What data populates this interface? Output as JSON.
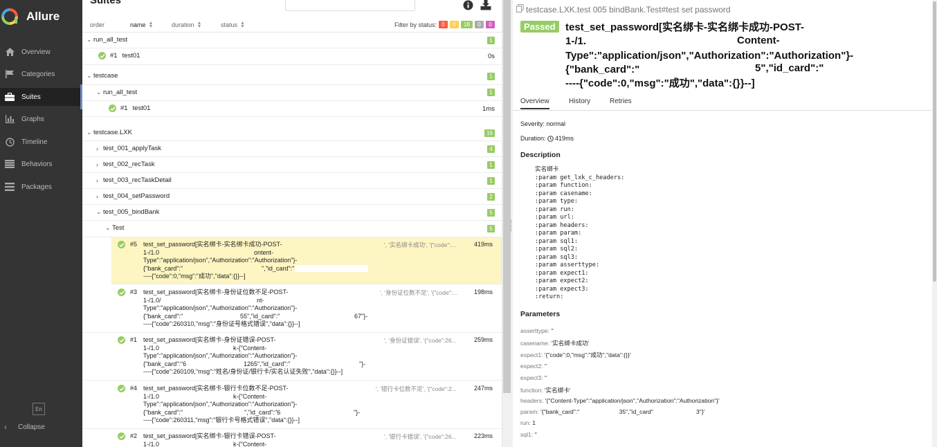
{
  "sidebar": {
    "app_name": "Allure",
    "items": [
      {
        "label": "Overview",
        "icon": "home-icon"
      },
      {
        "label": "Categories",
        "icon": "flag-icon"
      },
      {
        "label": "Suites",
        "icon": "briefcase-icon"
      },
      {
        "label": "Graphs",
        "icon": "bar-chart-icon"
      },
      {
        "label": "Timeline",
        "icon": "clock-icon"
      },
      {
        "label": "Behaviors",
        "icon": "list-icon"
      },
      {
        "label": "Packages",
        "icon": "stack-icon"
      }
    ],
    "active": "Suites",
    "language": "En",
    "collapse_label": "Collapse"
  },
  "suites": {
    "title": "Suites",
    "columns": {
      "order": "order",
      "name": "name",
      "duration": "duration",
      "status": "status"
    },
    "filter_label": "Filter by status:",
    "filter_counts": [
      {
        "value": "0",
        "color": "#fd5a3e"
      },
      {
        "value": "0",
        "color": "#ffd050"
      },
      {
        "value": "18",
        "color": "#97cc64"
      },
      {
        "value": "0",
        "color": "#aaaaaa"
      },
      {
        "value": "0",
        "color": "#d35ebe"
      }
    ],
    "groups": {
      "run_all_test": {
        "name": "run_all_test",
        "count": "1",
        "leaf_num": "#1",
        "leaf_name": "test01",
        "leaf_duration": "0s"
      },
      "testcase": {
        "name": "testcase",
        "count": "1",
        "sub_name": "run_all_test",
        "sub_count": "1",
        "leaf_num": "#1",
        "leaf_name": "test01",
        "leaf_duration": "1ms"
      },
      "lxk": {
        "name": "testcase.LXK",
        "count": "16"
      }
    },
    "subgroups": [
      {
        "name": "test_001_applyTask",
        "count": "4"
      },
      {
        "name": "test_002_recTask",
        "count": "1"
      },
      {
        "name": "test_003_recTaskDetail",
        "count": "1"
      },
      {
        "name": "test_004_setPassword",
        "count": "2"
      },
      {
        "name": "test_005_bindBank",
        "count": "5"
      },
      {
        "name": "Test",
        "count": "5"
      }
    ],
    "testcases": [
      {
        "num": "#5",
        "extra": "', '实名绑卡成功', '{\"code\":...",
        "duration": "419ms",
        "lines": [
          "test_set_password[实名绑卡-实名绑卡成功-POST-",
          "1-/1.0",
          "Type\":\"application/json\",\"Authorization\":\"Authorization\"}-",
          "{\"bank_card\":\"",
          "----{\"code\":0,\"msg\":\"成功\",\"data\":{}}--]"
        ],
        "frag2": "ontent-",
        "frag3": "\",\"id_card\":\""
      },
      {
        "num": "#3",
        "extra": "', '身份证位数不足', '{\"code\":...",
        "duration": "198ms",
        "lines": [
          "test_set_password[实名绑卡-身份证位数不足-POST-",
          "1-/1.0/",
          "Type\":\"application/json\",\"Authorization\":\"Authorization\"}-",
          "{\"bank_card\":\"",
          "----{\"code\":260310,\"msg\":\"身份证号格式错误\",\"data\":{}}--]"
        ],
        "frag2": "nt-",
        "frag3": "55\",\"id_card\":\"",
        "frag4": "67\"}-"
      },
      {
        "num": "#1",
        "extra": "', '身份证错误', '{\"code\":26...",
        "duration": "259ms",
        "lines": [
          "test_set_password[实名绑卡-身份证错误-POST-",
          "1-/1.0",
          "Type\":\"application/json\",\"Authorization\":\"Authorization\"}-",
          "{\"bank_card\":\"6",
          "----{\"code\":260109,\"msg\":\"姓名/身份证/银行卡/实名认证失败\",\"data\":{}}--]"
        ],
        "frag2": "k-{\"Content-",
        "frag3": "1265\",\"id_card\":\"",
        "frag4": "\"}-"
      },
      {
        "num": "#4",
        "extra": "', '银行卡位数不足', '{\"code\":2...",
        "duration": "247ms",
        "lines": [
          "test_set_password[实名绑卡-银行卡位数不足-POST-",
          "1-/1.0",
          "Type\":\"application/json\",\"Authorization\":\"Authorization\"}-",
          "{\"bank_card\":\"",
          "----{\"code\":260311,\"msg\":\"银行卡号格式错误\",\"data\":{}}--]"
        ],
        "frag2": "k-{\"Content-",
        "frag3": "\",\"id_card\":\"6",
        "frag4": "\"}-"
      },
      {
        "num": "#2",
        "extra": "', '银行卡错误', '{\"code\":26...",
        "duration": "223ms",
        "lines": [
          "test_set_password[实名绑卡-银行卡错误-POST-",
          "1-/1.0"
        ],
        "frag2": "k-{\"Content-"
      }
    ]
  },
  "details": {
    "breadcrumb": "testcase.LXK.test  005  bindBank.Test#test  set  password",
    "status": "Passed",
    "title_lines": [
      "test_set_password[实名绑卡-实名绑卡成功-POST-",
      "1-/1.",
      "Type\":\"application/json\",\"Authorization\":\"Authorization\"}-",
      "{\"bank_card\":\"",
      "----{\"code\":0,\"msg\":\"成功\",\"data\":{}}--]"
    ],
    "title_frag2": "Content-",
    "title_frag3": "5\",\"id_card\":\"",
    "tabs": [
      "Overview",
      "History",
      "Retries"
    ],
    "severity_label": "Severity:",
    "severity": "normal",
    "duration_label": "Duration:",
    "duration": "419ms",
    "description_title": "Description",
    "description": "实名绑卡\n:param get_lxk_c_headers:\n:param function:\n:param casename:\n:param type:\n:param run:\n:param url:\n:param headers:\n:param param:\n:param sql1:\n:param sql2:\n:param sql3:\n:param asserttype:\n:param expect1:\n:param expect2:\n:param expect3:\n:return:",
    "parameters_title": "Parameters",
    "parameters": [
      {
        "k": "asserttype:",
        "v": "''"
      },
      {
        "k": "casename:",
        "v": "'实名绑卡成功'"
      },
      {
        "k": "expect1:",
        "v": "'{\"code\":0,\"msg\":\"成功\",\"data\":{}}'"
      },
      {
        "k": "expect2:",
        "v": "''"
      },
      {
        "k": "expect3:",
        "v": "''"
      },
      {
        "k": "function:",
        "v": "'实名绑卡'"
      },
      {
        "k": "headers:",
        "v": "'{\"Content-Type\":\"application/json\",\"Authorization\":\"Authorization\"}'"
      },
      {
        "k": "param:",
        "v": "'{\"bank_card\":\"                        35\",\"id_card\"                          3\"}'"
      },
      {
        "k": "run:",
        "v": "1"
      },
      {
        "k": "sql1:",
        "v": "''"
      }
    ]
  }
}
